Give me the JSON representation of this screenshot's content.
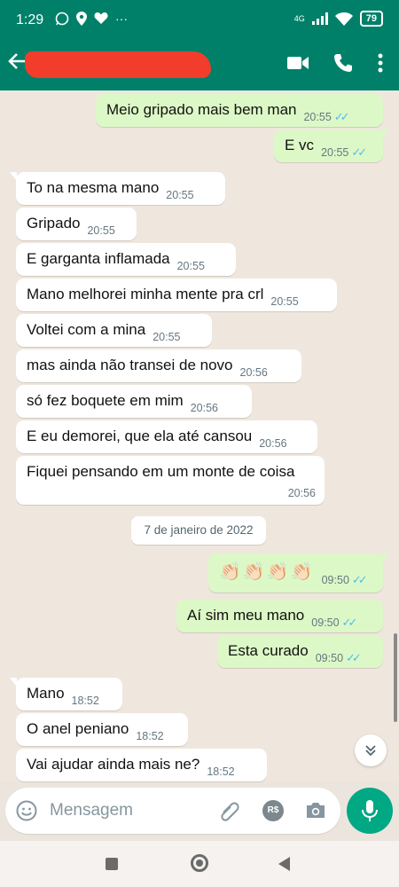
{
  "status_bar": {
    "time": "1:29",
    "network": "4G",
    "battery": "79"
  },
  "header": {
    "back_icon": "arrow-left-icon",
    "contact_name_redacted": true,
    "actions": [
      "video-call-icon",
      "phone-icon",
      "more-vert-icon"
    ]
  },
  "messages": [
    {
      "dir": "out",
      "text": "Meio gripado mais bem man",
      "time": "20:55",
      "read": true
    },
    {
      "dir": "out",
      "text": "E vc",
      "time": "20:55",
      "read": true
    },
    {
      "dir": "in",
      "text": "To na mesma mano",
      "time": "20:55"
    },
    {
      "dir": "in",
      "text": "Gripado",
      "time": "20:55"
    },
    {
      "dir": "in",
      "text": "E garganta inflamada",
      "time": "20:55"
    },
    {
      "dir": "in",
      "text": "Mano melhorei minha mente pra crl",
      "time": "20:55"
    },
    {
      "dir": "in",
      "text": "Voltei com a mina",
      "time": "20:55"
    },
    {
      "dir": "in",
      "text": "mas ainda não transei de novo",
      "time": "20:56"
    },
    {
      "dir": "in",
      "text": "só fez boquete em mim",
      "time": "20:56"
    },
    {
      "dir": "in",
      "text": "E eu demorei, que ela até cansou",
      "time": "20:56"
    },
    {
      "dir": "in",
      "text": "Fiquei pensando em um monte de coisa",
      "time": "20:56"
    },
    {
      "dir": "out",
      "text": "👏🏻👏🏻👏🏻👏🏻",
      "time": "09:50",
      "read": true
    },
    {
      "dir": "out",
      "text": "Aí sim meu mano",
      "time": "09:50",
      "read": true
    },
    {
      "dir": "out",
      "text": "Esta curado",
      "time": "09:50",
      "read": true
    },
    {
      "dir": "in",
      "text": "Mano",
      "time": "18:52"
    },
    {
      "dir": "in",
      "text": "O anel peniano",
      "time": "18:52"
    },
    {
      "dir": "in",
      "text": "Vai ajudar ainda mais ne?",
      "time": "18:52"
    }
  ],
  "date_separator": "7 de janeiro de 2022",
  "composer": {
    "placeholder": "Mensagem",
    "payment_label": "R$"
  },
  "colors": {
    "header": "#008069",
    "outgoing_bubble": "#dcf8c6",
    "incoming_bubble": "#ffffff",
    "read_ticks": "#53bdeb",
    "mic_button": "#00a884"
  }
}
